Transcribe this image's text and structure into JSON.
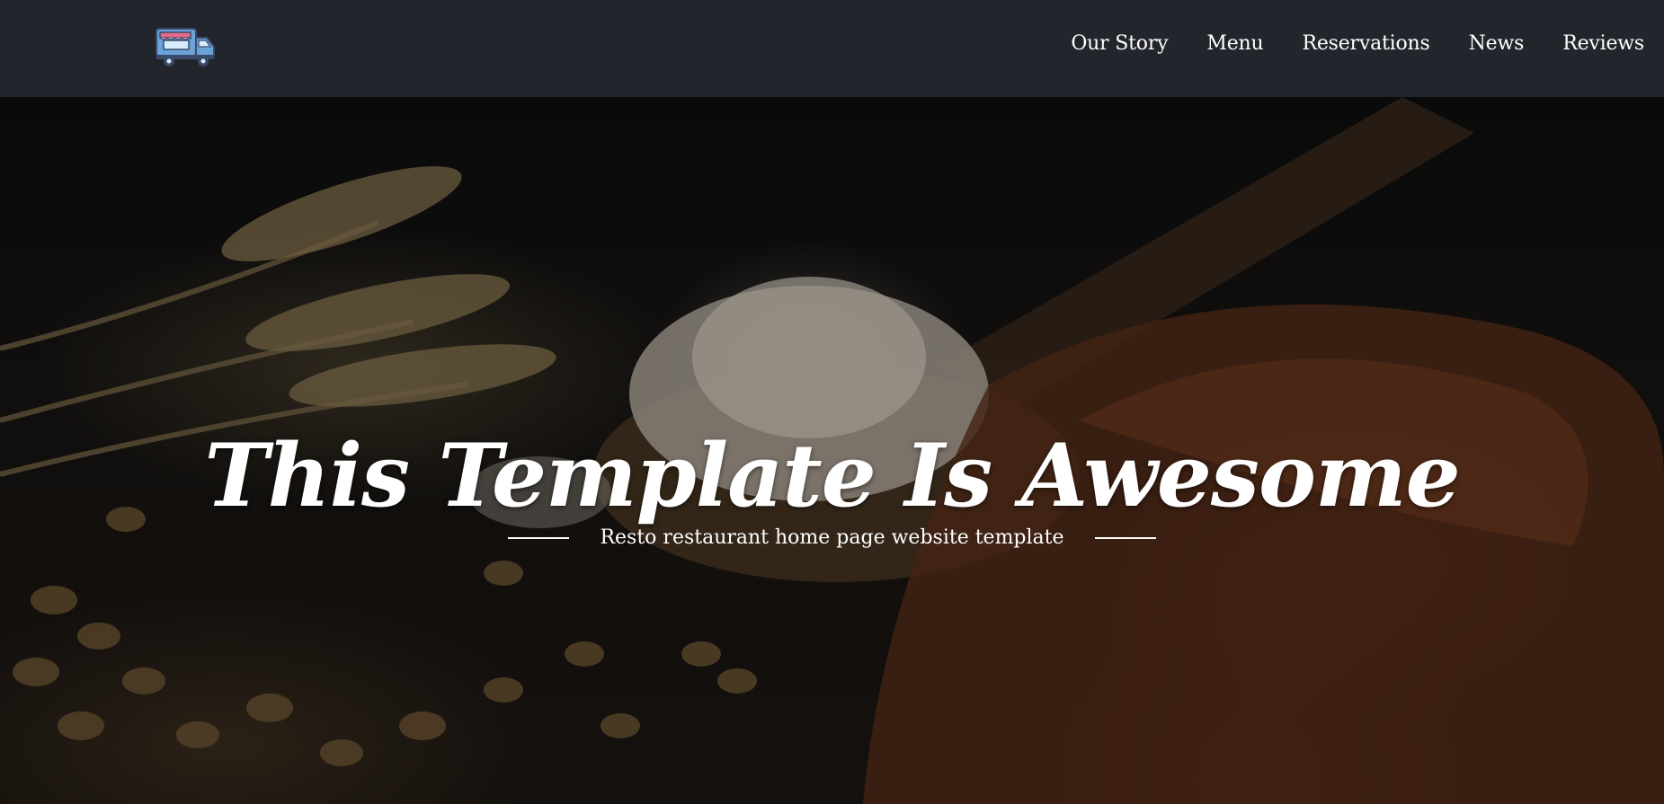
{
  "logo": {
    "icon": "food-truck-icon",
    "colors": {
      "body": "#6aa3d8",
      "trim": "#e46a8a",
      "outline": "#3b4a6b"
    }
  },
  "nav": {
    "items": [
      {
        "label": "Our Story"
      },
      {
        "label": "Menu"
      },
      {
        "label": "Reservations"
      },
      {
        "label": "News"
      },
      {
        "label": "Reviews"
      }
    ]
  },
  "hero": {
    "title": "This Template Is Awesome",
    "subtitle": "Resto restaurant home page website template",
    "background_icon": "bread-flour-wheat-photo"
  },
  "colors": {
    "navbar_bg": "#22252b",
    "text": "#ffffff"
  }
}
